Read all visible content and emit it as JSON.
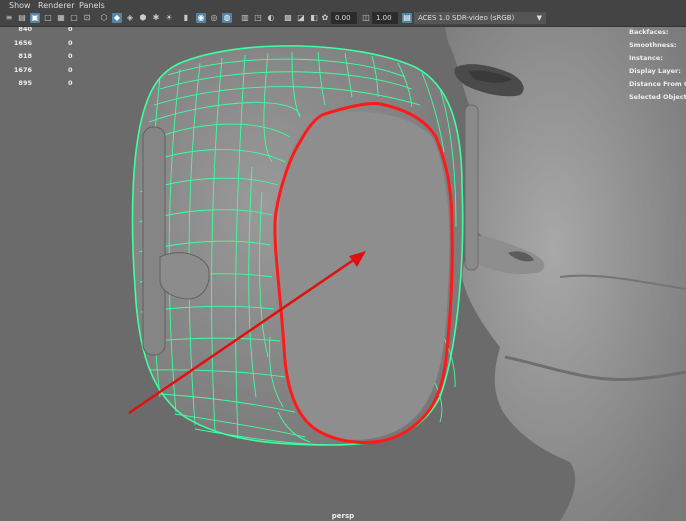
{
  "menu": {
    "items": [
      "Show",
      "Renderer",
      "Panels"
    ]
  },
  "toolbar": {
    "icons": [
      "menu-icon",
      "camera-icon",
      "film-gate-icon",
      "resolution-gate-icon",
      "grid-icon",
      "safe-action-icon",
      "field-chart-icon",
      "wireframe-cube-icon",
      "smooth-shade-icon",
      "textured-icon",
      "bounding-box-icon",
      "lights-icon",
      "shadows-icon",
      "isolate-select-icon",
      "xray-icon",
      "xray-joints-icon",
      "backface-icon",
      "image-plane-icon",
      "ambient-occlusion-icon",
      "exposure-icon",
      "gamma-icon"
    ],
    "exposure_value": "0.00",
    "gamma_value": "1.00",
    "color_space": "ACES 1.0 SDR-video (sRGB)"
  },
  "hud_left": {
    "rows": [
      {
        "a": "840",
        "b": "0"
      },
      {
        "a": "1656",
        "b": "0"
      },
      {
        "a": "818",
        "b": "0"
      },
      {
        "a": "1676",
        "b": "0"
      },
      {
        "a": "895",
        "b": "0"
      }
    ]
  },
  "hud_right": {
    "labels": [
      "Backfaces:",
      "Smoothness:",
      "Instance:",
      "Display Layer:",
      "Distance From Ca",
      "Selected Objects"
    ]
  },
  "viewport": {
    "camera": "persp",
    "colors": {
      "background": "#6b6b6b",
      "wireframe": "#3dffa0",
      "highlight": "#ff1a1a",
      "mesh": "#8a8a8a"
    }
  }
}
